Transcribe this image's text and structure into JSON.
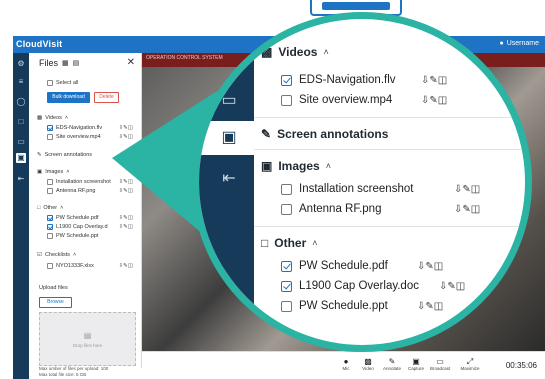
{
  "app": {
    "brand": "CloudVisit",
    "username": "Username"
  },
  "rail_icons": [
    "settings-icon",
    "list-icon",
    "person-icon",
    "chat-icon",
    "screen-share-icon",
    "folder-icon",
    "exit-icon"
  ],
  "files_panel": {
    "title": "Files",
    "select_all": "Select all",
    "bulk_download": "Bulk download",
    "delete": "Delete",
    "sections": {
      "videos": "Videos",
      "screen_annotations": "Screen annotations",
      "images": "Images",
      "other": "Other",
      "checklists": "Checklists"
    },
    "videos": [
      {
        "name": "EDS-Navigation.flv",
        "checked": true
      },
      {
        "name": "Site overview.mp4",
        "checked": false
      }
    ],
    "images": [
      {
        "name": "Installation screenshot",
        "checked": false
      },
      {
        "name": "Antenna RF.png",
        "checked": false
      }
    ],
    "other": [
      {
        "name": "PW Schedule.pdf",
        "checked": true
      },
      {
        "name": "L1900 Cap Overlay.d",
        "checked": true
      },
      {
        "name": "PW Schedule.ppt",
        "checked": false
      }
    ],
    "checklists": [
      {
        "name": "NYO1333F.xlsx",
        "checked": false
      }
    ],
    "upload_title": "Upload files",
    "browse": "Browse",
    "drop_text": "Drop files here",
    "max_files": "Max umber of files per upload: 100",
    "max_size": "Max total file size: 5 GB"
  },
  "zoom_panel": {
    "videos": "Videos",
    "video_items": [
      {
        "name": "EDS-Navigation.flv",
        "checked": true
      },
      {
        "name": "Site overview.mp4",
        "checked": false
      }
    ],
    "screen_annotations": "Screen annotations",
    "images": "Images",
    "image_items": [
      {
        "name": "Installation screenshot",
        "checked": false
      },
      {
        "name": "Antenna RF.png",
        "checked": false
      }
    ],
    "other": "Other",
    "other_items": [
      {
        "name": "PW Schedule.pdf",
        "checked": true
      },
      {
        "name": "L1900 Cap Overlay.doc",
        "checked": true
      },
      {
        "name": "PW Schedule.ppt",
        "checked": false
      }
    ]
  },
  "video": {
    "banner": "OPERATION CONTROL SYSTEM"
  },
  "bottom_bar": {
    "items": [
      "Mic",
      "Video",
      "Annotate",
      "Capture",
      "Broadcast",
      "Maximize"
    ],
    "timer": "00:35:06"
  },
  "colors": {
    "brand": "#1f73c4",
    "rail": "#163b5a",
    "ring": "#2bb3a3",
    "delete": "#d9534f"
  }
}
